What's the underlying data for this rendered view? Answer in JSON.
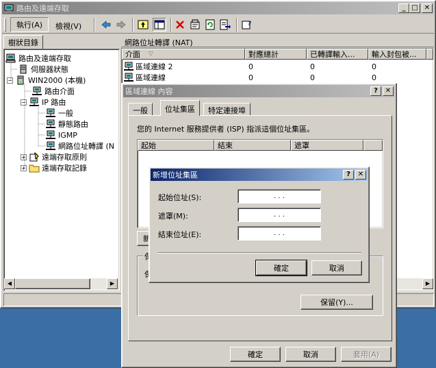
{
  "main_window": {
    "title": "路由及遠端存取",
    "menu": [
      {
        "label": "執行(A)"
      },
      {
        "label": "檢視(V)"
      }
    ]
  },
  "tree": {
    "tab_label": "樹狀目錄",
    "items": [
      {
        "label": "路由及遠端存取"
      },
      {
        "label": "伺服器狀態"
      },
      {
        "label": "WIN2000 (本機)"
      },
      {
        "label": "路由介面"
      },
      {
        "label": "IP 路由"
      },
      {
        "label": "一般"
      },
      {
        "label": "靜態路由"
      },
      {
        "label": "IGMP"
      },
      {
        "label": "網路位址轉譯 (N"
      },
      {
        "label": "遠端存取原則"
      },
      {
        "label": "遠端存取記錄"
      }
    ]
  },
  "details": {
    "title": "網路位址轉譯 (NAT)",
    "columns": [
      "介面",
      "對應總計",
      "已轉譯輸入...",
      "輸入封包被..."
    ],
    "rows": [
      {
        "name": "區域連線 2",
        "mappings": "0",
        "translated": "0",
        "rejected": "0"
      },
      {
        "name": "區域連線",
        "mappings": "0",
        "translated": "0",
        "rejected": "0"
      }
    ]
  },
  "props_dialog": {
    "title": "區域連線 內容",
    "tabs": [
      "一般",
      "位址集區",
      "特定連接埠"
    ],
    "active_tab": 1,
    "description": "您的 Internet 服務提供者 (ISP) 指派這個位址集區。",
    "pool_columns": [
      "起始",
      "結束",
      "遮罩"
    ],
    "partial_add_label": "新",
    "group_label": "保",
    "group_text": "保",
    "reserve_button": "保留(Y)...",
    "ok": "確定",
    "cancel": "取消",
    "apply": "套用(A)"
  },
  "add_pool_dialog": {
    "title": "新增位址集區",
    "fields": [
      {
        "label": "起始位址(S):",
        "value": ". . ."
      },
      {
        "label": "遮罩(M):",
        "value": ". . ."
      },
      {
        "label": "結束位址(E):",
        "value": ". . ."
      }
    ],
    "ok": "確定",
    "cancel": "取消",
    "help_glyph": "?",
    "close_glyph": "✕"
  },
  "colors": {
    "desktop": "#3a6ea5",
    "face": "#d4d0c8",
    "title_active": "#0a246a",
    "title_inactive": "#808080"
  }
}
